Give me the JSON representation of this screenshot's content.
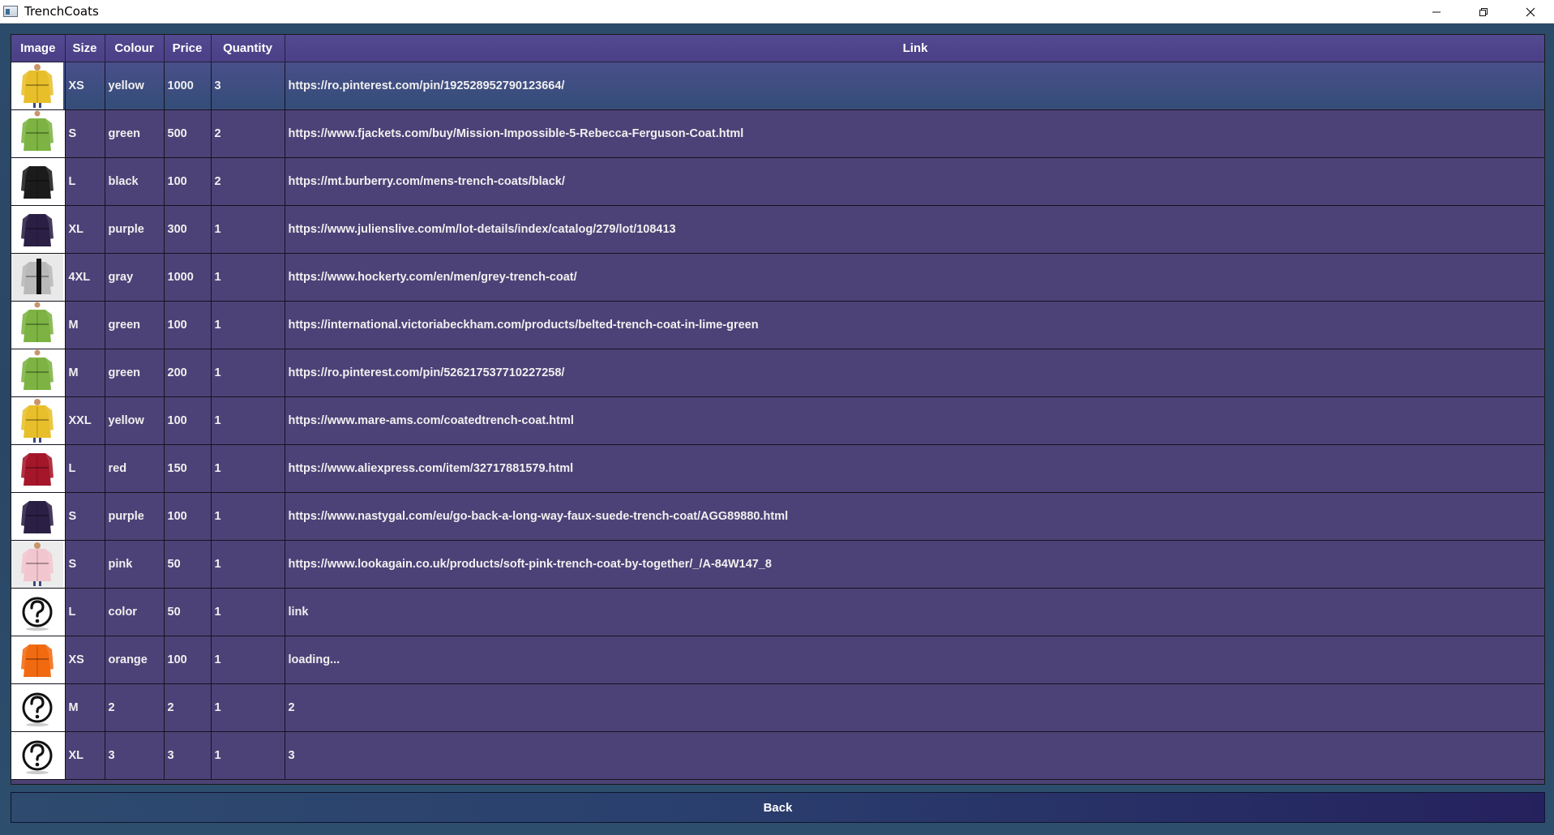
{
  "window": {
    "title": "TrenchCoats",
    "minimize_glyph": "—",
    "restore_icon": "restore-icon",
    "close_icon": "close-icon"
  },
  "table": {
    "headers": {
      "image": "Image",
      "size": "Size",
      "colour": "Colour",
      "price": "Price",
      "quantity": "Quantity",
      "link": "Link"
    },
    "rows": [
      {
        "image": "coat-yellow",
        "size": "XS",
        "colour": "yellow",
        "price": "1000",
        "quantity": "3",
        "link": "https://ro.pinterest.com/pin/192528952790123664/"
      },
      {
        "image": "coat-green",
        "size": "S",
        "colour": "green",
        "price": "500",
        "quantity": "2",
        "link": "https://www.fjackets.com/buy/Mission-Impossible-5-Rebecca-Ferguson-Coat.html"
      },
      {
        "image": "coat-black",
        "size": "L",
        "colour": "black",
        "price": "100",
        "quantity": "2",
        "link": "https://mt.burberry.com/mens-trench-coats/black/"
      },
      {
        "image": "coat-purple",
        "size": "XL",
        "colour": "purple",
        "price": "300",
        "quantity": "1",
        "link": "https://www.julienslive.com/m/lot-details/index/catalog/279/lot/108413"
      },
      {
        "image": "coat-gray",
        "size": "4XL",
        "colour": "gray",
        "price": "1000",
        "quantity": "1",
        "link": "https://www.hockerty.com/en/men/grey-trench-coat/"
      },
      {
        "image": "coat-green",
        "size": "M",
        "colour": "green",
        "price": "100",
        "quantity": "1",
        "link": "https://international.victoriabeckham.com/products/belted-trench-coat-in-lime-green"
      },
      {
        "image": "coat-green",
        "size": "M",
        "colour": "green",
        "price": "200",
        "quantity": "1",
        "link": "https://ro.pinterest.com/pin/526217537710227258/"
      },
      {
        "image": "coat-yellow",
        "size": "XXL",
        "colour": "yellow",
        "price": "100",
        "quantity": "1",
        "link": "https://www.mare-ams.com/coatedtrench-coat.html"
      },
      {
        "image": "coat-red",
        "size": "L",
        "colour": "red",
        "price": "150",
        "quantity": "1",
        "link": "https://www.aliexpress.com/item/32717881579.html"
      },
      {
        "image": "coat-purple",
        "size": "S",
        "colour": "purple",
        "price": "100",
        "quantity": "1",
        "link": "https://www.nastygal.com/eu/go-back-a-long-way-faux-suede-trench-coat/AGG89880.html"
      },
      {
        "image": "coat-pink",
        "size": "S",
        "colour": "pink",
        "price": "50",
        "quantity": "1",
        "link": "https://www.lookagain.co.uk/products/soft-pink-trench-coat-by-together/_/A-84W147_8"
      },
      {
        "image": "question-mark",
        "size": "L",
        "colour": "color",
        "price": "50",
        "quantity": "1",
        "link": "link"
      },
      {
        "image": "coat-orange",
        "size": "XS",
        "colour": "orange",
        "price": "100",
        "quantity": "1",
        "link": "loading..."
      },
      {
        "image": "question-mark",
        "size": "M",
        "colour": "2",
        "price": "2",
        "quantity": "1",
        "link": "2"
      },
      {
        "image": "question-mark",
        "size": "XL",
        "colour": "3",
        "price": "3",
        "quantity": "1",
        "link": "3"
      }
    ],
    "selected_row": 0
  },
  "back_button": {
    "label": "Back"
  },
  "colors": {
    "table_bg": "#4d4277",
    "header_bg": "#4b3f86",
    "window_bg": "#2b4c66",
    "selected_row": "#334d78",
    "coat-yellow": "#e8bf2a",
    "coat-green": "#7cb342",
    "coat-black": "#1b1b1b",
    "coat-purple": "#2c1f45",
    "coat-gray": "#b9b9b9",
    "coat-red": "#a5162a",
    "coat-pink": "#f2c6cf",
    "coat-orange": "#f26a10"
  }
}
